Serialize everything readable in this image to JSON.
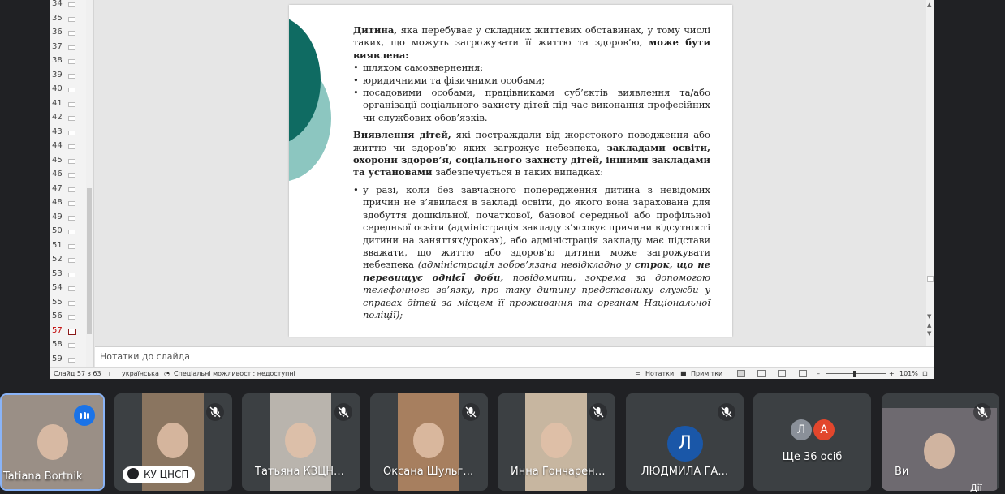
{
  "thumbnails": {
    "numbers": [
      "34",
      "35",
      "36",
      "37",
      "38",
      "39",
      "40",
      "41",
      "42",
      "43",
      "44",
      "45",
      "46",
      "47",
      "48",
      "49",
      "50",
      "51",
      "52",
      "53",
      "54",
      "55",
      "56",
      "57",
      "58",
      "59"
    ],
    "active": "57"
  },
  "slide": {
    "p1_bold": "Дитина,",
    "p1_text": " яка перебуває у складних життєвих обставинах, у тому числі таких, що можуть загрожувати її життю та здоров’ю, ",
    "p1_bold2": "може бути виявлена:",
    "bullets1": [
      "шляхом самозвернення;",
      "юридичними та фізичними особами;",
      "посадовими особами, працівниками суб’єктів виявлення та/або організації соціального захисту дітей під час виконання професійних чи службових обов’язків."
    ],
    "p2_bold": "Виявлення дітей,",
    "p2_text": " які постраждали від жорстокого поводження або життю чи здоров’ю яких загрожує небезпека, ",
    "p2_bold2": "закладами освіти, охорони здоров’я, соціального захисту дітей, іншими закладами та установами",
    "p2_text2": " забезпечується в таких випадках:",
    "b2_text": "у разі, коли без завчасного попередження дитина з невідомих причин не з’явилася в закладі освіти, до якого вона зарахована для здобуття дошкільної, початкової, базової середньої або профільної середньої освіти (адміністрація закладу з’ясовує причини відсутності дитини на заняттях/уроках), або адміністрація закладу має підстави вважати, що життю або здоров’ю дитини може загрожувати небезпека ",
    "b2_italic1": "(адміністрація зобов’язана невідкладно у ",
    "b2_bolditalic": "строк, що не перевищує однієї доби,",
    "b2_italic2": " повідомити, зокрема за допомогою телефонного зв’язку, про таку дитину представнику служби у справах дітей за місцем її проживання та органам Національної поліції);"
  },
  "notes_placeholder": "Нотатки до слайда",
  "status": {
    "slide_counter": "Слайд 57 з 63",
    "language": "українська",
    "accessibility": "Спеціальні можливості: недоступні",
    "notes_btn": "Нотатки",
    "comments_btn": "Примітки",
    "zoom_minus": "–",
    "zoom_plus": "+",
    "zoom_level": "101%"
  },
  "participants": [
    {
      "name": "Tatiana Bortnik",
      "bg": "#9a8f86"
    },
    {
      "name": "КУ ЦНСП",
      "bg": "#8a7560"
    },
    {
      "name": "Татьяна КЗЦН…",
      "bg": "#b9b4ad"
    },
    {
      "name": "Оксана Шульг…",
      "bg": "#a77f5f"
    },
    {
      "name": "Инна Гончарен…",
      "bg": "#c7b6a0"
    },
    {
      "name": "ЛЮДМИЛА ГА…",
      "initial": "Л",
      "bg": "#3c4043"
    },
    {
      "name": "Ще 36 осіб",
      "initials": [
        "Л",
        "А"
      ],
      "bg": "#3c4043"
    },
    {
      "name": "Ви",
      "bg": "#6e6a70"
    }
  ],
  "self_label": "Дії",
  "colors": {
    "teal_dark": "#0f6b62",
    "teal_light": "#8cc6c0",
    "accent_blue": "#1a73e8"
  }
}
